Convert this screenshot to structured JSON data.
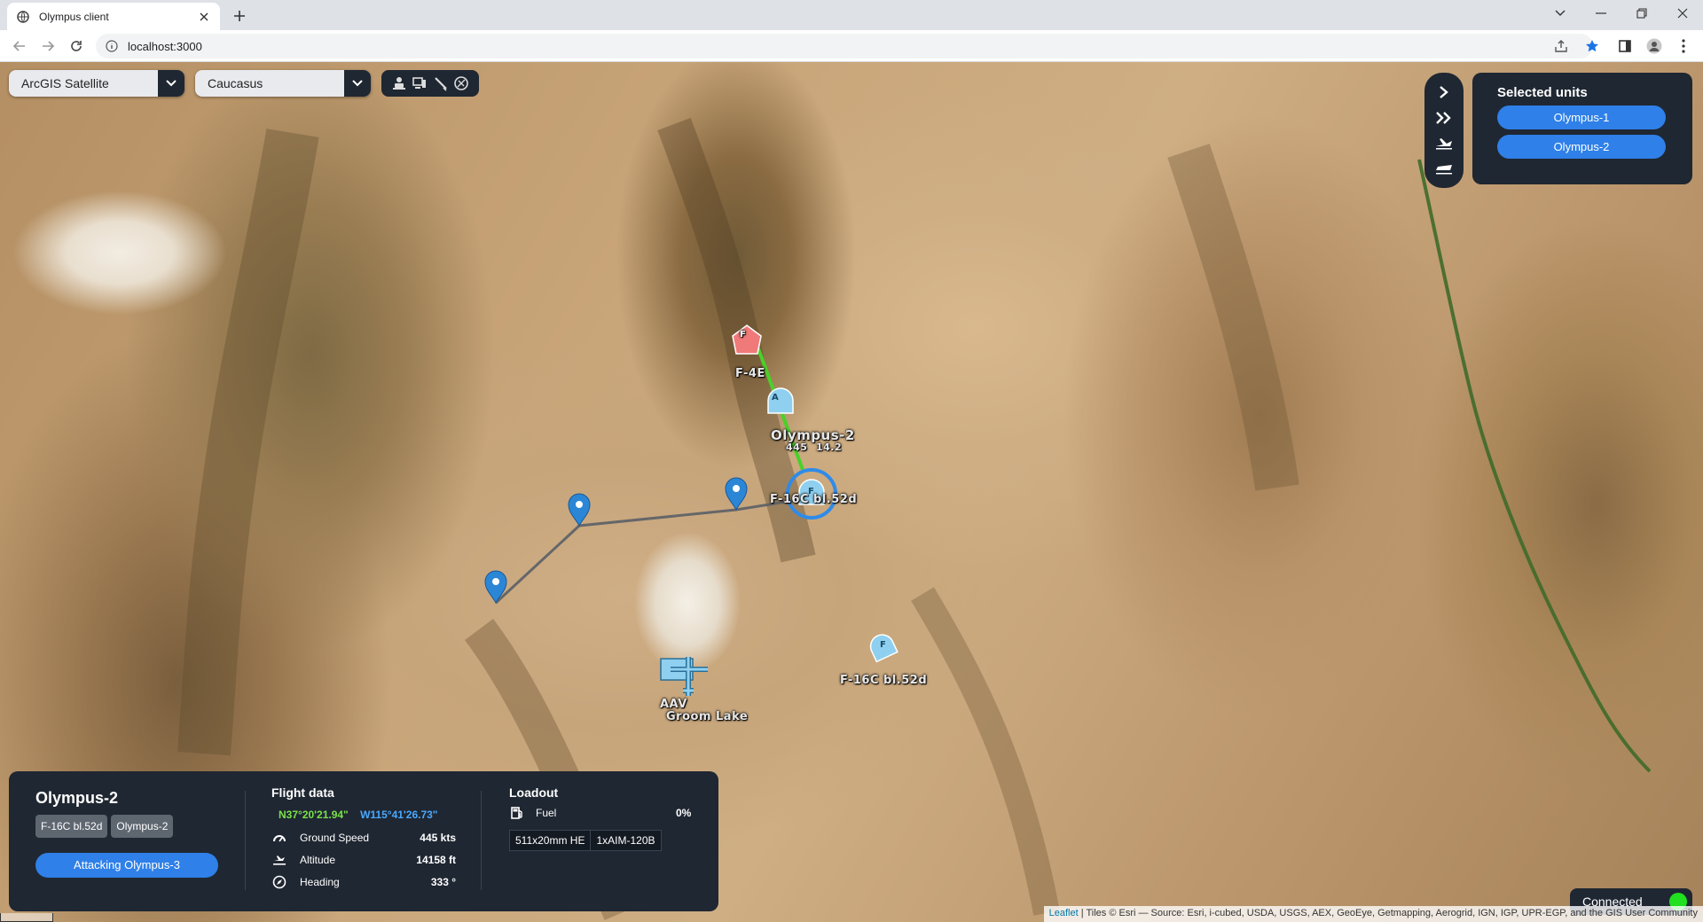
{
  "browser": {
    "tab_title": "Olympus client",
    "url": "localhost:3000"
  },
  "map_controls": {
    "layer_select": "ArcGIS Satellite",
    "theatre_select": "Caucasus"
  },
  "selected_units": {
    "title": "Selected units",
    "units": [
      "Olympus-1",
      "Olympus-2"
    ]
  },
  "map_markers": {
    "enemy_label": "F-4E",
    "enemy_glyph": "F",
    "escort_glyph": "A",
    "selected_name": "Olympus-2",
    "selected_speed": "445",
    "selected_alt": "14.2",
    "selected_type": "F-16C bl.52d",
    "selected_glyph": "F",
    "wingman_type": "F-16C bl.52d",
    "wingman_glyph": "F",
    "airbase_label": "AAV",
    "airbase_name": "Groom Lake"
  },
  "unit_info": {
    "name": "Olympus-2",
    "tags": [
      "F-16C bl.52d",
      "Olympus-2"
    ],
    "task": "Attacking Olympus-3"
  },
  "flight_data": {
    "title": "Flight data",
    "latitude": "N37°20'21.94\"",
    "longitude": "W115°41'26.73\"",
    "rows": [
      {
        "label": "Ground Speed",
        "value": "445 kts"
      },
      {
        "label": "Altitude",
        "value": "14158 ft"
      },
      {
        "label": "Heading",
        "value": "333 °"
      }
    ]
  },
  "loadout": {
    "title": "Loadout",
    "fuel_label": "Fuel",
    "fuel_value": "0%",
    "items": [
      "511x20mm HE",
      "1xAIM-120B"
    ]
  },
  "status": {
    "label": "Connected",
    "color": "#20e020"
  },
  "attribution": {
    "leaflet": "Leaflet",
    "text": " | Tiles © Esri — Source: Esri, i-cubed, USDA, USGS, AEX, GeoEye, Getmapping, Aerogrid, IGN, IGP, UPR-EGP, and the GIS User Community"
  },
  "colors": {
    "panel_bg": "#1f2732",
    "accent": "#2f80e8",
    "friendly": "#8fd0f0",
    "enemy": "#f07a7a",
    "waypoint": "#2b86d6"
  }
}
